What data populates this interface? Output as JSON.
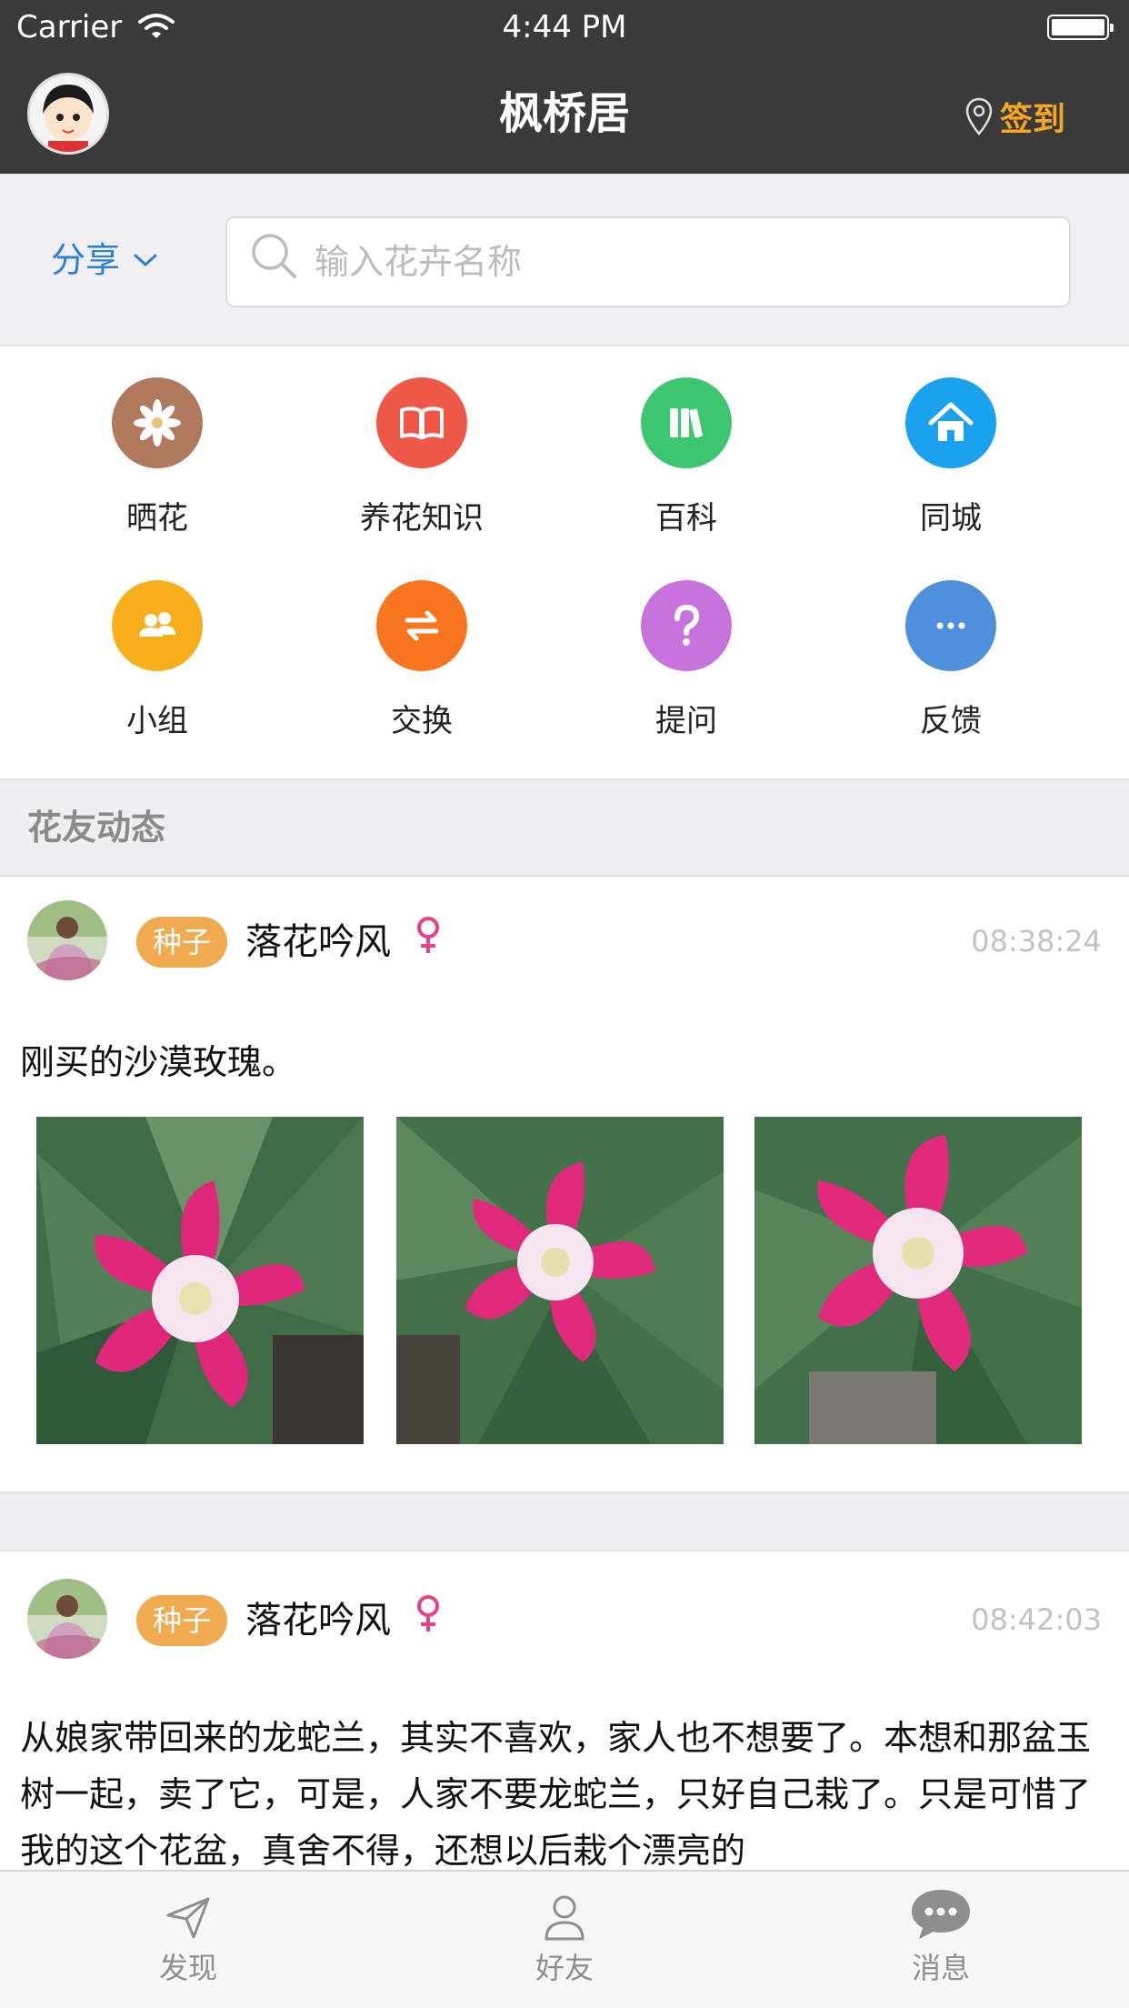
{
  "status_bar": {
    "carrier": "Carrier",
    "time": "4:44 PM"
  },
  "nav": {
    "title": "枫桥居",
    "checkin_label": "签到"
  },
  "toolbar": {
    "share_label": "分享",
    "search_placeholder": "输入花卉名称"
  },
  "categories": [
    {
      "label": "晒花",
      "icon": "flower-icon",
      "color": "#b0785d"
    },
    {
      "label": "养花知识",
      "icon": "book-icon",
      "color": "#ef5847"
    },
    {
      "label": "百科",
      "icon": "books-icon",
      "color": "#3cc66f"
    },
    {
      "label": "同城",
      "icon": "home-icon",
      "color": "#1aa2ef"
    },
    {
      "label": "小组",
      "icon": "group-icon",
      "color": "#f6ae1a"
    },
    {
      "label": "交换",
      "icon": "exchange-icon",
      "color": "#f9741e"
    },
    {
      "label": "提问",
      "icon": "question-icon",
      "color": "#c772dd"
    },
    {
      "label": "反馈",
      "icon": "more-icon",
      "color": "#4f90dc"
    }
  ],
  "feed": {
    "section_title": "花友动态",
    "posts": [
      {
        "badge": "种子",
        "username": "落花吟风",
        "gender": "female",
        "time": "08:38:24",
        "text": "刚买的沙漠玫瑰。",
        "photo_count": 3
      },
      {
        "badge": "种子",
        "username": "落花吟风",
        "gender": "female",
        "time": "08:42:03",
        "text": "从娘家带回来的龙蛇兰，其实不喜欢，家人也不想要了。本想和那盆玉树一起，卖了它，可是，人家不要龙蛇兰，只好自己栽了。只是可惜了我的这个花盆，真舍不得，还想以后栽个漂亮的"
      }
    ]
  },
  "tabs": [
    {
      "label": "发现",
      "icon": "send-icon"
    },
    {
      "label": "好友",
      "icon": "person-icon"
    },
    {
      "label": "消息",
      "icon": "chat-icon"
    }
  ],
  "colors": {
    "nav_bg": "#3a3a3a",
    "accent": "#f5a623",
    "link": "#2b7fd6",
    "badge": "#f0aa4f",
    "female": "#e8408a"
  }
}
